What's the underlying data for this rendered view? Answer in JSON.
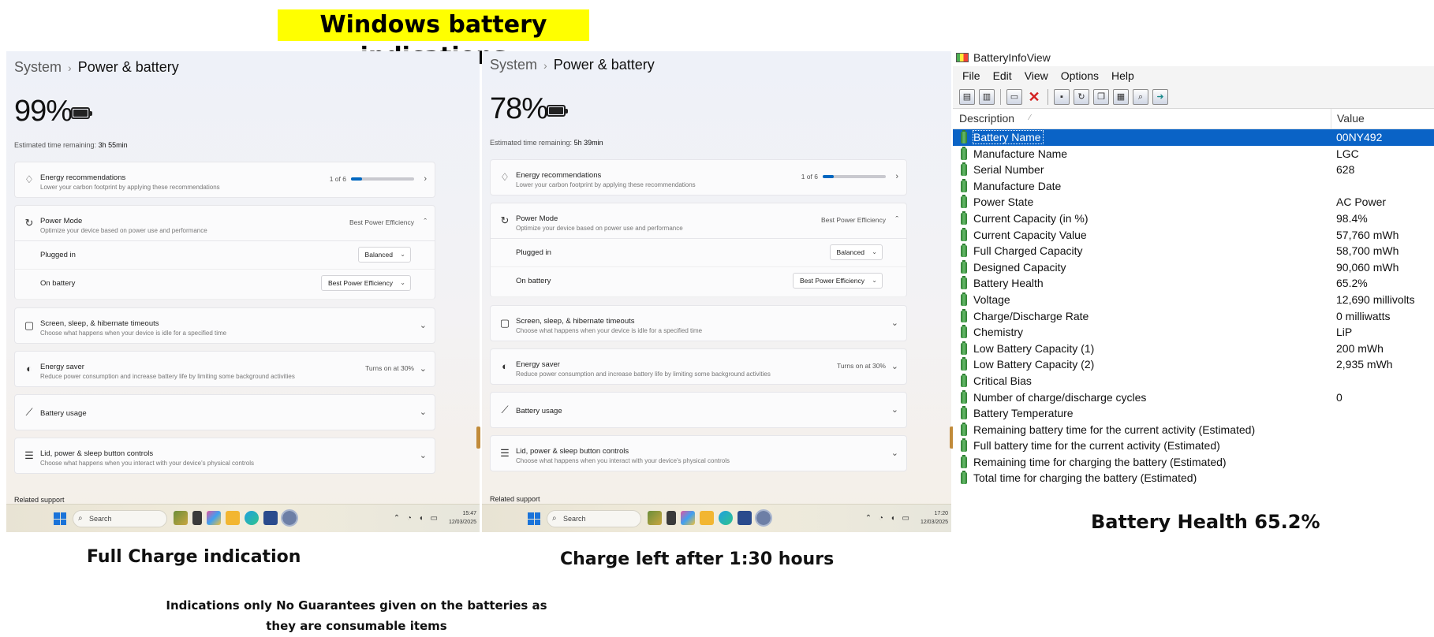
{
  "main_title": "Windows battery indications",
  "panels": {
    "full": {
      "breadcrumb_parent": "System",
      "breadcrumb_current": "Power & battery",
      "percent": "99%",
      "est_label": "Estimated time remaining:",
      "est_value": "3h 55min",
      "energy_rec_title": "Energy recommendations",
      "energy_rec_sub": "Lower your carbon footprint by applying these recommendations",
      "energy_rec_count": "1 of 6",
      "energy_rec_progress": 0.17,
      "power_mode_title": "Power Mode",
      "power_mode_sub": "Optimize your device based on power use and performance",
      "power_mode_value": "Best Power Efficiency",
      "plugged_in_label": "Plugged in",
      "plugged_in_value": "Balanced",
      "on_battery_label": "On battery",
      "on_battery_value": "Best Power Efficiency",
      "screen_title": "Screen, sleep, & hibernate timeouts",
      "screen_sub": "Choose what happens when your device is idle for a specified time",
      "saver_title": "Energy saver",
      "saver_sub": "Reduce power consumption and increase battery life by limiting some background activities",
      "saver_value": "Turns on at 30%",
      "usage_title": "Battery usage",
      "lid_title": "Lid, power & sleep button controls",
      "lid_sub": "Choose what happens when you interact with your device's physical controls",
      "related": "Related support",
      "search": "Search",
      "time": "15:47",
      "date": "12/03/2025"
    },
    "partial": {
      "breadcrumb_parent": "System",
      "breadcrumb_current": "Power & battery",
      "percent": "78%",
      "est_label": "Estimated time remaining:",
      "est_value": "5h 39min",
      "energy_rec_title": "Energy recommendations",
      "energy_rec_sub": "Lower your carbon footprint by applying these recommendations",
      "energy_rec_count": "1 of 6",
      "energy_rec_progress": 0.17,
      "power_mode_title": "Power Mode",
      "power_mode_sub": "Optimize your device based on power use and performance",
      "power_mode_value": "Best Power Efficiency",
      "plugged_in_label": "Plugged in",
      "plugged_in_value": "Balanced",
      "on_battery_label": "On battery",
      "on_battery_value": "Best Power Efficiency",
      "screen_title": "Screen, sleep, & hibernate timeouts",
      "screen_sub": "Choose what happens when your device is idle for a specified time",
      "saver_title": "Energy saver",
      "saver_sub": "Reduce power consumption and increase battery life by limiting some background activities",
      "saver_value": "Turns on at 30%",
      "usage_title": "Battery usage",
      "lid_title": "Lid, power & sleep button controls",
      "lid_sub": "Choose what happens when you interact with your device's physical controls",
      "related": "Related support",
      "search": "Search",
      "time": "17:20",
      "date": "12/03/2025"
    }
  },
  "captions": {
    "full": "Full Charge indication",
    "partial": "Charge left after 1:30 hours",
    "health": "Battery Health 65.2%",
    "disclaimer": "Indications only No Guarantees given on the batteries as they are consumable items"
  },
  "biv": {
    "title": "BatteryInfoView",
    "menu": [
      "File",
      "Edit",
      "View",
      "Options",
      "Help"
    ],
    "col_description": "Description",
    "col_value": "Value",
    "rows": [
      {
        "desc": "Battery Name",
        "val": "00NY492",
        "selected": true
      },
      {
        "desc": "Manufacture Name",
        "val": "LGC"
      },
      {
        "desc": "Serial Number",
        "val": "628"
      },
      {
        "desc": "Manufacture Date",
        "val": ""
      },
      {
        "desc": "Power State",
        "val": "AC Power"
      },
      {
        "desc": "Current Capacity (in %)",
        "val": "98.4%"
      },
      {
        "desc": "Current Capacity Value",
        "val": "57,760 mWh"
      },
      {
        "desc": "Full Charged Capacity",
        "val": "58,700 mWh"
      },
      {
        "desc": "Designed Capacity",
        "val": "90,060 mWh"
      },
      {
        "desc": "Battery Health",
        "val": "65.2%"
      },
      {
        "desc": "Voltage",
        "val": "12,690 millivolts"
      },
      {
        "desc": "Charge/Discharge Rate",
        "val": "0 milliwatts"
      },
      {
        "desc": "Chemistry",
        "val": "LiP"
      },
      {
        "desc": "Low Battery Capacity (1)",
        "val": "200 mWh"
      },
      {
        "desc": "Low Battery Capacity (2)",
        "val": "2,935 mWh"
      },
      {
        "desc": "Critical Bias",
        "val": ""
      },
      {
        "desc": "Number of charge/discharge cycles",
        "val": "0"
      },
      {
        "desc": "Battery Temperature",
        "val": ""
      },
      {
        "desc": "Remaining battery time for the current activity (Estimated)",
        "val": ""
      },
      {
        "desc": "Full battery time for the current activity (Estimated)",
        "val": ""
      },
      {
        "desc": "Remaining time for charging the battery (Estimated)",
        "val": ""
      },
      {
        "desc": "Total  time for charging the battery (Estimated)",
        "val": ""
      }
    ]
  },
  "colors": {
    "title_highlight": "#ffff00",
    "accent_blue": "#0067c0",
    "selection_blue": "#0a63c6",
    "battery_green": "#43a047"
  }
}
